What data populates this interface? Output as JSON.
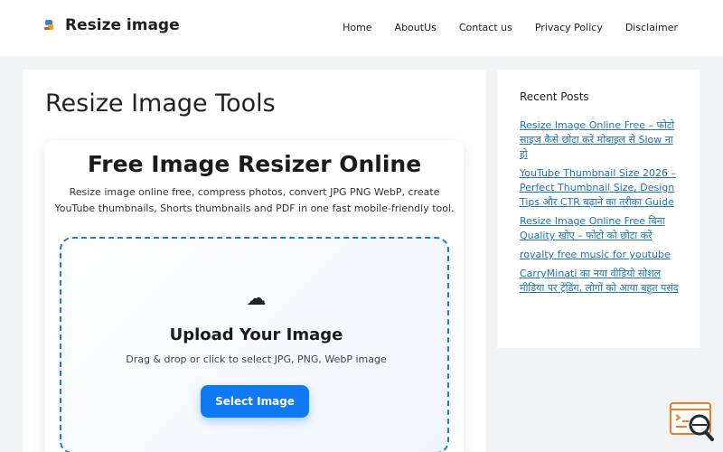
{
  "header": {
    "site_title": "Resize image",
    "nav": [
      "Home",
      "AboutUs",
      "Contact us",
      "Privacy Policy",
      "Disclaimer"
    ]
  },
  "main": {
    "page_title": "Resize Image Tools",
    "tool": {
      "heading": "Free Image Resizer Online",
      "description": "Resize image online free, compress photos, convert JPG PNG WebP, create YouTube thumbnails, Shorts thumbnails and PDF in one fast mobile-friendly tool.",
      "upload_icon": "☁",
      "upload_title": "Upload Your Image",
      "upload_hint": "Drag & drop or click to select JPG, PNG, WebP image",
      "select_button": "Select Image"
    }
  },
  "sidebar": {
    "title": "Recent Posts",
    "posts": [
      "Resize Image Online Free – फोटो साइज कैसे छोटा करें मोबाइल से Slow ना हो",
      "YouTube Thumbnail Size 2026 – Perfect Thumbnail Size, Design Tips और CTR बढ़ाने का तरीका Guide",
      "Resize Image Online Free बिना Quality खोए – फोटो को छोटा करें",
      "royalty free music for youtube",
      "CarryMinati का नया वीडियो सोशल मीडिया पर ट्रेंडिंग, लोगों को आया बहुत पसंद"
    ]
  },
  "colors": {
    "accent": "#0f7af3",
    "link": "#1e73be",
    "dropzone_border": "#1e7bd6",
    "page_bg": "#f1f3f5"
  },
  "icons": {
    "logo": "image-resize-logo",
    "upload": "cloud-icon",
    "floating": "search-document-icon"
  }
}
